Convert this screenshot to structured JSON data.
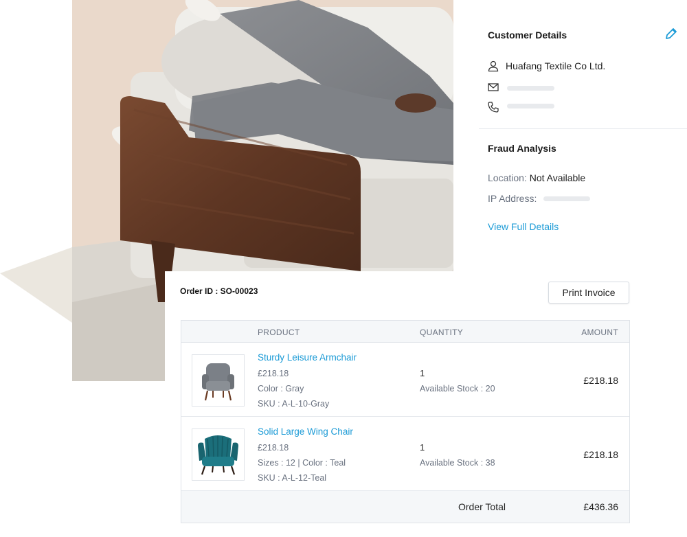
{
  "customer": {
    "title": "Customer Details",
    "name": "Huafang Textile Co Ltd.",
    "edit_icon": "pencil-icon",
    "contact_icons": [
      "user-icon",
      "mail-icon",
      "phone-icon"
    ]
  },
  "fraud": {
    "title": "Fraud Analysis",
    "location_label": "Location:",
    "location_value": "Not Available",
    "ip_label": "IP Address:",
    "view_link": "View Full Details"
  },
  "order": {
    "id_label": "Order ID : SO-00023",
    "print_label": "Print Invoice",
    "columns": {
      "product": "PRODUCT",
      "quantity": "QUANTITY",
      "amount": "AMOUNT"
    },
    "items": [
      {
        "name": "Sturdy Leisure Armchair",
        "price": "£218.18",
        "attrs": "Color : Gray",
        "sku": "SKU : A-L-10-Gray",
        "quantity": "1",
        "stock": "Available Stock : 20",
        "amount": "£218.18",
        "color": "#7b8087"
      },
      {
        "name": "Solid Large Wing Chair",
        "price": "£218.18",
        "attrs": "Sizes : 12 | Color : Teal",
        "sku": "SKU : A-L-12-Teal",
        "quantity": "1",
        "stock": "Available Stock : 38",
        "amount": "£218.18",
        "color": "#1b6e7a"
      }
    ],
    "total_label": "Order Total",
    "total_value": "£436.36"
  },
  "colors": {
    "accent": "#1a9ad6"
  }
}
